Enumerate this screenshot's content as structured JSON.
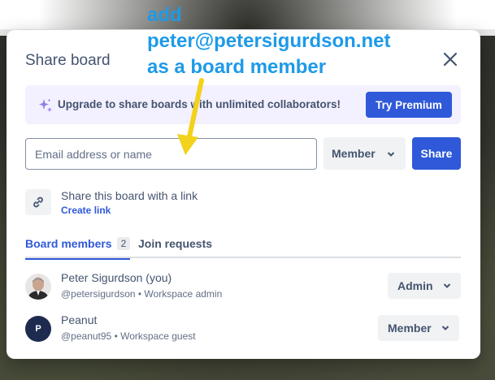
{
  "annotation": {
    "line1": "add",
    "line2": "peter@petersigurdson.net",
    "line3": "as a board member",
    "color": "#1e9ae8",
    "arrow_color": "#f2d21b"
  },
  "dialog": {
    "title": "Share board",
    "close_icon": "close-icon"
  },
  "banner": {
    "icon": "sparkle-icon",
    "text": "Upgrade to share boards with unlimited collaborators!",
    "button_label": "Try Premium"
  },
  "invite": {
    "placeholder": "Email address or name",
    "value": "",
    "role_label": "Member",
    "share_label": "Share"
  },
  "share_link": {
    "icon": "link-icon",
    "text": "Share this board with a link",
    "create_label": "Create link"
  },
  "tabs": [
    {
      "label": "Board members",
      "count": "2",
      "active": true
    },
    {
      "label": "Join requests",
      "active": false
    }
  ],
  "members": [
    {
      "name": "Peter Sigurdson (you)",
      "sub": "@petersigurdson • Workspace admin",
      "role": "Admin",
      "avatar": "photo"
    },
    {
      "name": "Peanut",
      "sub": "@peanut95 • Workspace guest",
      "role": "Member",
      "avatar_initial": "P"
    }
  ],
  "colors": {
    "accent": "#2f59d9",
    "banner_bg": "#f3f0ff",
    "text": "#44546f"
  }
}
